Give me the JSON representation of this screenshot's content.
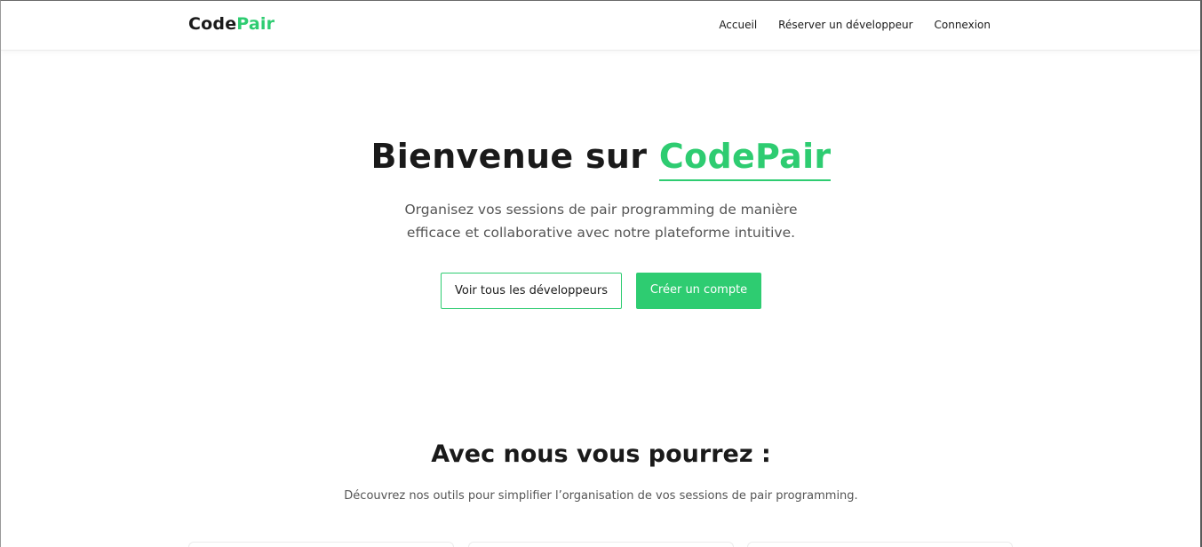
{
  "header": {
    "logo_part1": "Code",
    "logo_part2": "Pair",
    "nav": [
      "Accueil",
      "Réserver un développeur",
      "Connexion"
    ]
  },
  "hero": {
    "title_prefix": "Bienvenue sur ",
    "title_accent": "CodePair",
    "subtitle": "Organisez vos sessions de pair programming de manière efficace et collaborative avec notre plateforme intuitive.",
    "btn_secondary": "Voir tous les développeurs",
    "btn_primary": "Créer un compte"
  },
  "features": {
    "title": "Avec nous vous pourrez :",
    "subtitle": "Découvrez nos outils pour simplifier l’organisation de vos sessions de pair programming."
  },
  "colors": {
    "accent": "#2ecc71",
    "text": "#1a1a1a",
    "muted": "#555555"
  }
}
